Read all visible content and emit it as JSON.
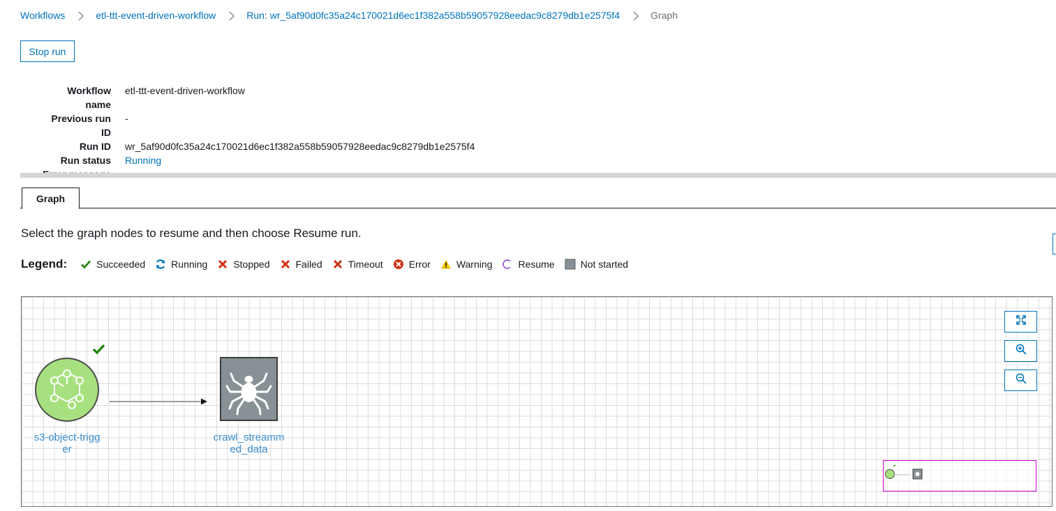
{
  "breadcrumb": {
    "items": [
      "Workflows",
      "etl-ttt-event-driven-workflow",
      "Run: wr_5af90d0fc35a24c170021d6ec1f382a558b59057928eedac9c8279db1e2575f4"
    ],
    "current": "Graph"
  },
  "actions": {
    "stop_run": "Stop run"
  },
  "details": {
    "workflow_name_label": [
      "Workflow",
      "name"
    ],
    "workflow_name": "etl-ttt-event-driven-workflow",
    "previous_run_label": [
      "Previous run",
      "ID"
    ],
    "previous_run": "-",
    "run_id_label": "Run ID",
    "run_id": "wr_5af90d0fc35a24c170021d6ec1f382a558b59057928eedac9c8279db1e2575f4",
    "run_status_label": "Run status",
    "run_status": "Running",
    "error_message_label": "Error message"
  },
  "tabs": [
    {
      "label": "Graph"
    }
  ],
  "instruction": "Select the graph nodes to resume and then choose Resume run.",
  "legend": {
    "title": "Legend:",
    "items": [
      {
        "label": "Succeeded",
        "icon": "check-icon",
        "color": "#1d8102"
      },
      {
        "label": "Running",
        "icon": "refresh-icon",
        "color": "#0073bb"
      },
      {
        "label": "Stopped",
        "icon": "x-icon",
        "color": "#d13212"
      },
      {
        "label": "Failed",
        "icon": "x-icon",
        "color": "#d13212"
      },
      {
        "label": "Timeout",
        "icon": "x-icon",
        "color": "#d13212"
      },
      {
        "label": "Error",
        "icon": "x-circle-icon",
        "color": "#d13212"
      },
      {
        "label": "Warning",
        "icon": "warning-icon",
        "color": "#f2c200"
      },
      {
        "label": "Resume",
        "icon": "resume-icon",
        "color": "#8b3cd6"
      },
      {
        "label": "Not started",
        "icon": "square-icon",
        "color": "#879196"
      }
    ]
  },
  "graph": {
    "nodes": [
      {
        "label": [
          "s3-object-trigg",
          "er"
        ],
        "type": "trigger",
        "status": "Succeeded",
        "color": "#a7e17f"
      },
      {
        "label": [
          "crawl_streamm",
          "ed_data"
        ],
        "type": "crawler",
        "status": "Not started",
        "color": "#879196"
      }
    ],
    "controls": [
      "fit-icon",
      "zoom-in-icon",
      "zoom-out-icon"
    ]
  }
}
